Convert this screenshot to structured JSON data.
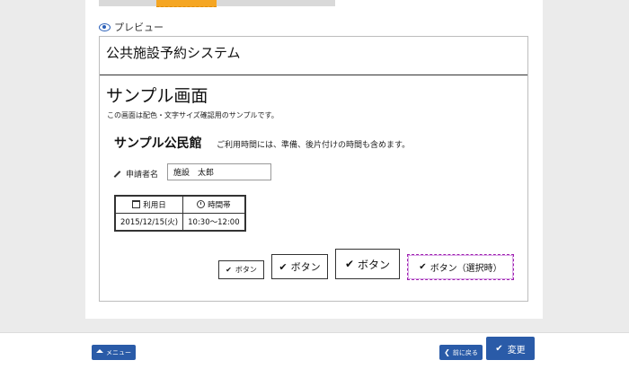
{
  "preview": {
    "label": "プレビュー"
  },
  "system": {
    "title": "公共施設予約システム"
  },
  "sample": {
    "title": "サンプル画面",
    "description": "この画面は配色・文字サイズ確認用のサンプルです。",
    "facility_name": "サンプル公民館",
    "facility_note": "ご利用時間には、準備、後片付けの時間も含めます。"
  },
  "applicant": {
    "label": "申請者名",
    "value": "施設　太郎"
  },
  "reservation_table": {
    "headers": [
      "利用日",
      "時間帯"
    ],
    "rows": [
      [
        "2015/12/15(火)",
        "10:30～12:00"
      ]
    ]
  },
  "buttons": {
    "small": "ボタン",
    "medium": "ボタン",
    "large": "ボタン",
    "selected": "ボタン（選択時）"
  },
  "footer": {
    "menu_label": "メニュー",
    "back_label": "前に戻る",
    "change_label": "変更"
  },
  "colors": {
    "accent_tab": "#f5a623",
    "primary": "#2a5ba8",
    "selected_border": "#a020b0"
  }
}
